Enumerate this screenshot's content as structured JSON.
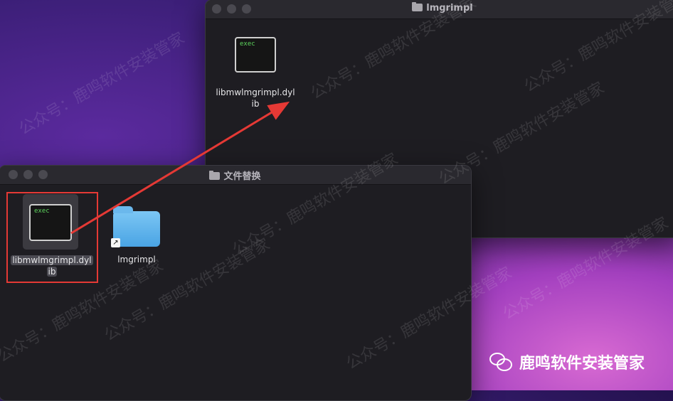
{
  "window_back": {
    "title": "lmgrimpl",
    "file_label_1": "libmwlmgrimpl.dyl",
    "file_label_2": "ib"
  },
  "window_front": {
    "title": "文件替换",
    "file": {
      "icon_text": "exec",
      "label_1": "libmwlmgrimpl.dyl",
      "label_2": "ib"
    },
    "folder": {
      "label": "lmgrimpl",
      "alias_glyph": "↗"
    }
  },
  "exec_icon_text": "exec",
  "watermark_text": "公众号：鹿鸣软件安装管家",
  "brand": {
    "name": "鹿鸣软件安装管家",
    "icon": "wechat-icon"
  },
  "annotation": {
    "highlight_color": "#e53935",
    "arrow_color": "#e53935"
  }
}
